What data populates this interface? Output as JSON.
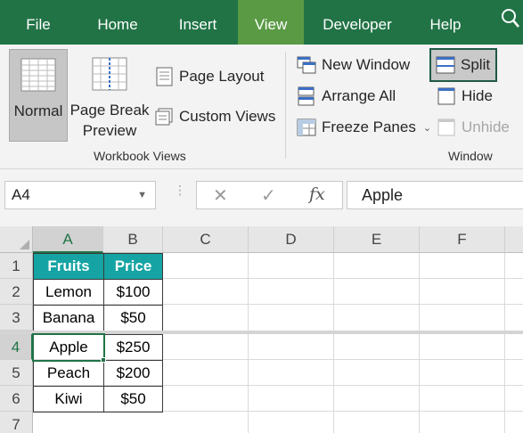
{
  "menu": {
    "tabs": [
      {
        "label": "File"
      },
      {
        "label": "Home"
      },
      {
        "label": "Insert"
      },
      {
        "label": "View"
      },
      {
        "label": "Developer"
      },
      {
        "label": "Help"
      }
    ],
    "active_tab": "View"
  },
  "ribbon": {
    "workbook_views": {
      "label": "Workbook Views",
      "normal": "Normal",
      "page_break_line1": "Page Break",
      "page_break_line2": "Preview",
      "page_layout": "Page Layout",
      "custom_views": "Custom Views"
    },
    "window": {
      "label": "Window",
      "new_window": "New Window",
      "arrange_all": "Arrange All",
      "freeze_panes": "Freeze Panes",
      "split": "Split",
      "hide": "Hide",
      "unhide": "Unhide"
    }
  },
  "formula_bar": {
    "name_box": "A4",
    "formula_value": "Apple",
    "fx": "fx"
  },
  "grid": {
    "columns": [
      "A",
      "B",
      "C",
      "D",
      "E",
      "F"
    ],
    "rows": [
      "1",
      "2",
      "3",
      "4",
      "5",
      "6",
      "7"
    ],
    "table": {
      "header": [
        "Fruits",
        "Price"
      ],
      "rows": [
        [
          "Lemon",
          "$100"
        ],
        [
          "Banana",
          "$50"
        ],
        [
          "Apple",
          "$250"
        ],
        [
          "Peach",
          "$200"
        ],
        [
          "Kiwi",
          "$50"
        ]
      ]
    },
    "selected_cell": "A4"
  },
  "colors": {
    "menu_bg": "#217346",
    "active_tab_bg": "#5a9a45",
    "table_header_bg": "#16a3a3",
    "selection_accent": "#217346"
  }
}
